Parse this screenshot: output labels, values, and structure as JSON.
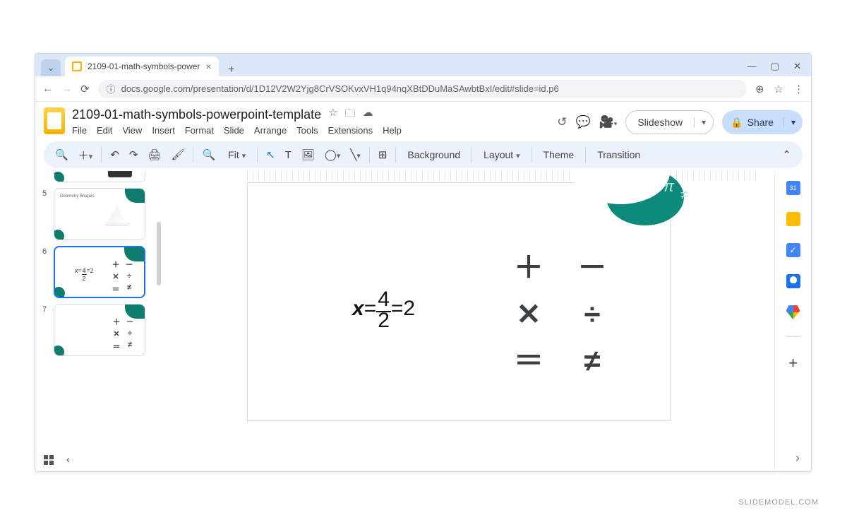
{
  "browser": {
    "tab_title": "2109-01-math-symbols-power",
    "url": "docs.google.com/presentation/d/1D12V2W2Yjg8CrVSOKvxVH1q94nqXBtDDuMaSAwbtBxI/edit#slide=id.p6"
  },
  "doc": {
    "title": "2109-01-math-symbols-powerpoint-template"
  },
  "menu": {
    "file": "File",
    "edit": "Edit",
    "view": "View",
    "insert": "Insert",
    "format": "Format",
    "slide": "Slide",
    "arrange": "Arrange",
    "tools": "Tools",
    "extensions": "Extensions",
    "help": "Help"
  },
  "header_buttons": {
    "slideshow": "Slideshow",
    "share": "Share"
  },
  "toolbar": {
    "zoom": "Fit",
    "background": "Background",
    "layout": "Layout",
    "theme": "Theme",
    "transition": "Transition"
  },
  "thumbnails": {
    "n4": "",
    "n5": "5",
    "label5": "Geometry Shapes",
    "n6": "6",
    "n7": "7"
  },
  "slide": {
    "formula_x": "x",
    "formula_eq": "=",
    "formula_top": "4",
    "formula_bot": "2",
    "formula_eq2": "=2",
    "ops": {
      "plus": "＋",
      "minus": "－",
      "times": "✕",
      "divide": "÷",
      "equals": "＝",
      "ne": "≠"
    }
  },
  "watermark": "SLIDEMODEL.COM"
}
